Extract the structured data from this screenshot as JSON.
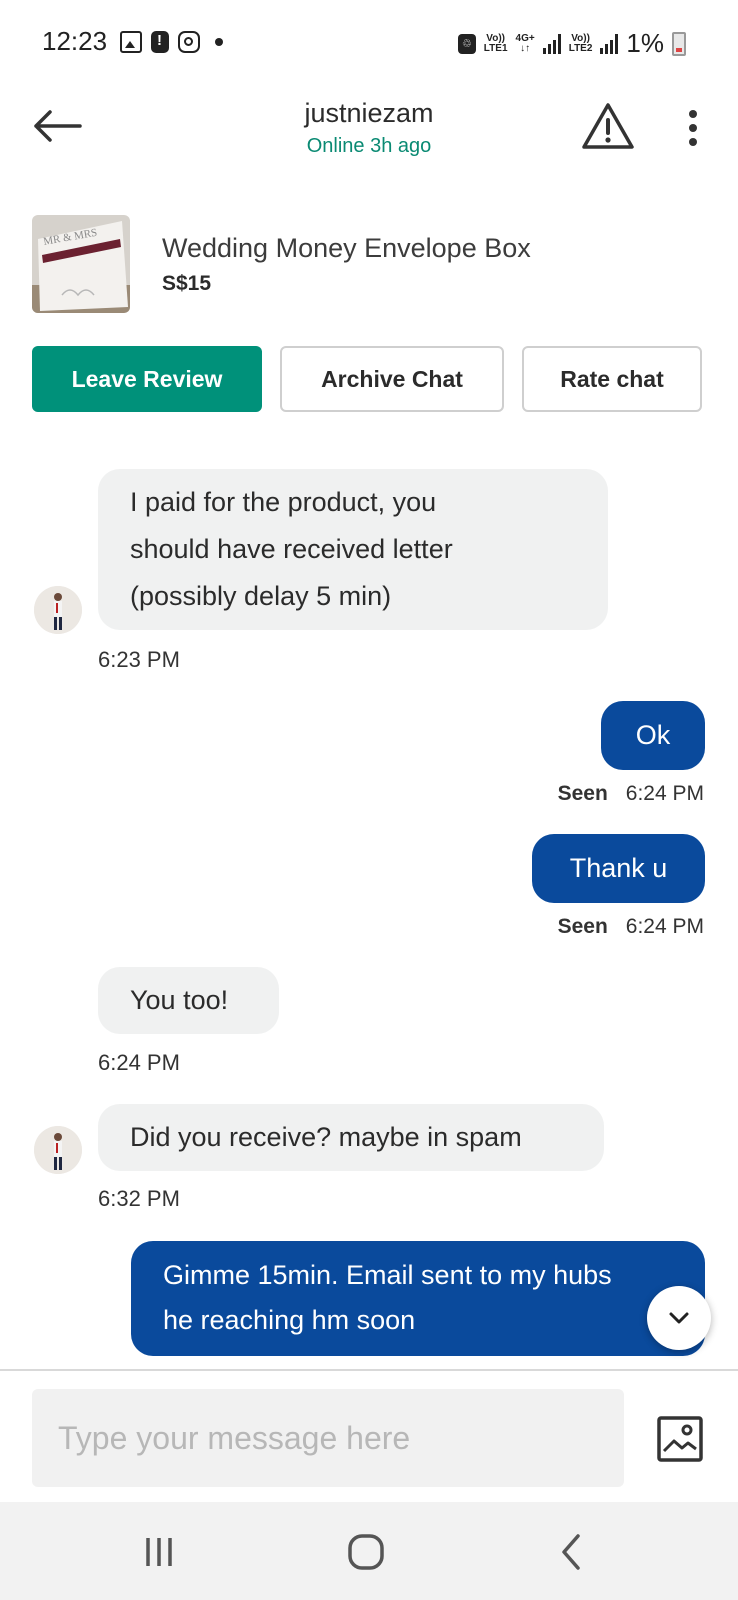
{
  "status_bar": {
    "time": "12:23",
    "icons": [
      "gallery-icon",
      "alert-icon",
      "instagram-icon",
      "dot-icon"
    ],
    "sim1_top": "Vo))",
    "sim1_bottom": "LTE1",
    "net": "4G+",
    "sim2_top": "Vo))",
    "sim2_bottom": "LTE2",
    "battery": "1%"
  },
  "header": {
    "username": "justniezam",
    "online_status": "Online 3h ago"
  },
  "listing": {
    "title": "Wedding Money Envelope Box",
    "price": "S$15",
    "thumb_text": "MR & MRS"
  },
  "actions": {
    "leave_review": "Leave Review",
    "archive_chat": "Archive Chat",
    "rate_chat": "Rate chat"
  },
  "messages": [
    {
      "from": "them",
      "lines": [
        "I paid for the product, you",
        "should have received  letter",
        "(possibly delay 5 min)"
      ],
      "time": "6:23 PM"
    },
    {
      "from": "me",
      "lines": [
        "Ok"
      ],
      "seen": "Seen",
      "time": "6:24 PM"
    },
    {
      "from": "me",
      "lines": [
        "Thank u"
      ],
      "seen": "Seen",
      "time": "6:24 PM"
    },
    {
      "from": "them",
      "lines": [
        "You too!"
      ],
      "time": "6:24 PM"
    },
    {
      "from": "them",
      "lines": [
        "Did you receive? maybe in spam"
      ],
      "time": "6:32 PM"
    },
    {
      "from": "me",
      "lines": [
        "Gimme 15min. Email sent to my hubs",
        "he reaching hm soon"
      ]
    }
  ],
  "composer": {
    "placeholder": "Type your message here"
  },
  "colors": {
    "accent_green": "#00917a",
    "outgoing_bubble": "#0a4a9c",
    "incoming_bubble": "#f0f1f1",
    "online_text": "#0a8a73"
  }
}
